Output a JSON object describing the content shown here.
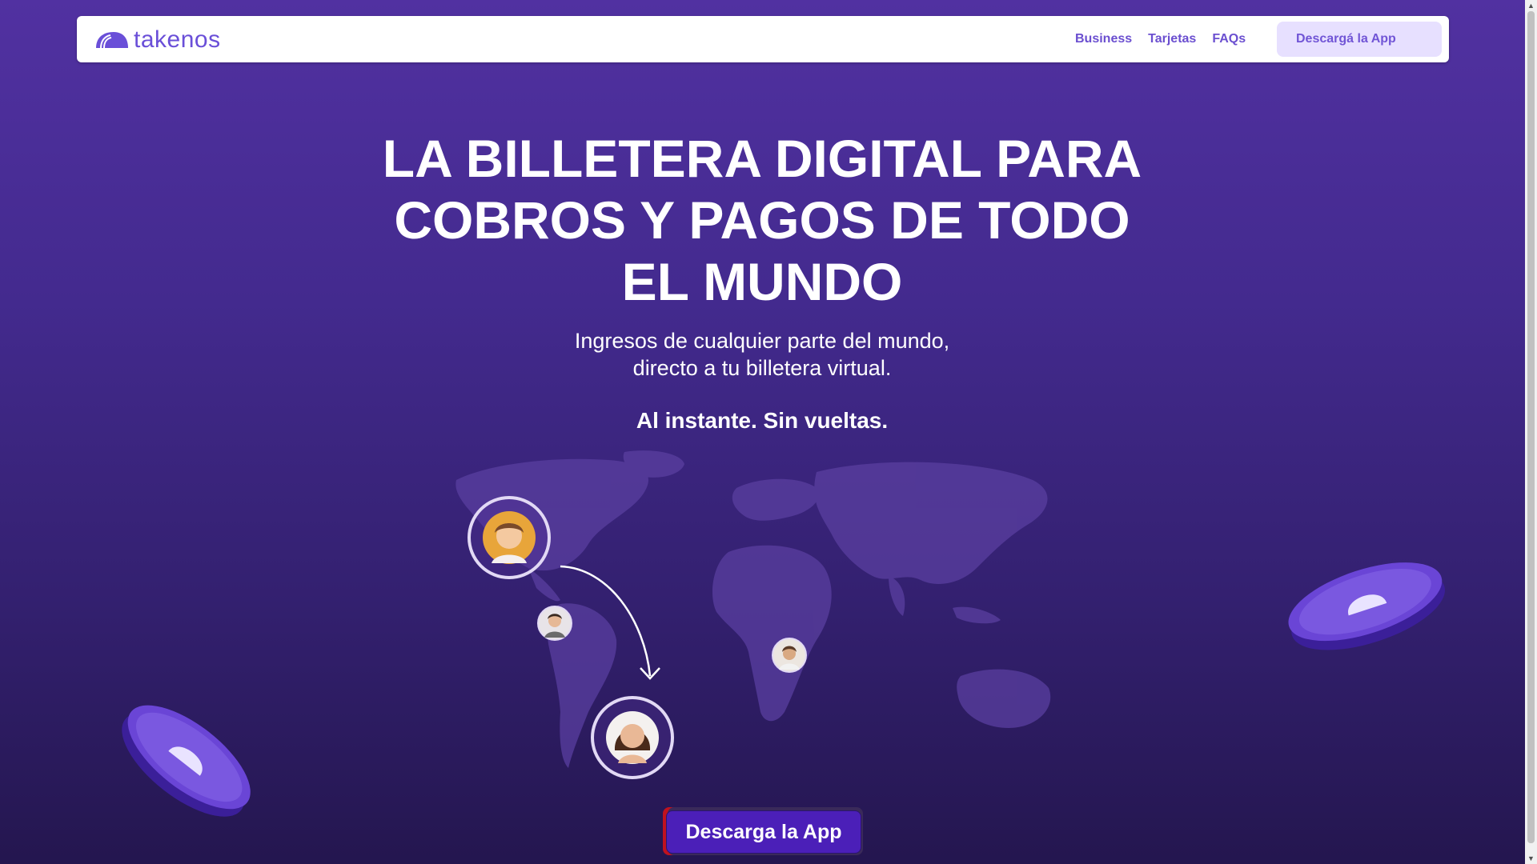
{
  "brand": {
    "name": "takenos",
    "color": "#6a4fd8"
  },
  "nav": {
    "links": [
      "Business",
      "Tarjetas",
      "FAQs"
    ],
    "cta": "Descargá la App"
  },
  "hero": {
    "headline": "LA BILLETERA DIGITAL PARA COBROS Y PAGOS DE TODO EL MUNDO",
    "subtitle_line1": "Ingresos de cualquier parte del mundo,",
    "subtitle_line2": "directo a tu billetera virtual.",
    "tagline": "Al instante. Sin vueltas.",
    "cta": "Descarga la App"
  },
  "colors": {
    "background_top": "#5131a1",
    "background_bottom": "#24164f",
    "cta": "#4b1fb8"
  }
}
